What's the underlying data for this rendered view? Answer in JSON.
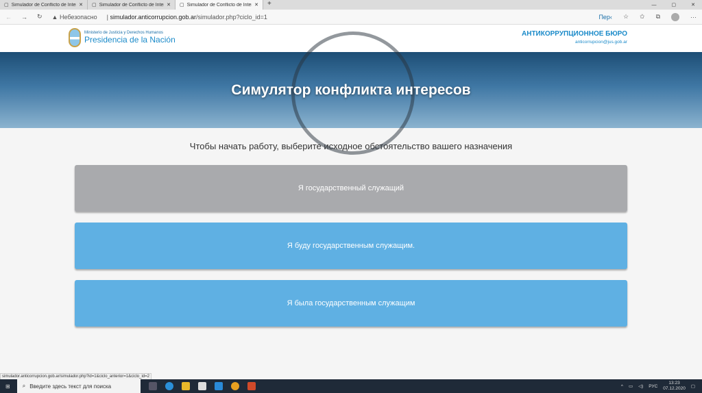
{
  "browser": {
    "tabs": [
      {
        "title": "Simulador de Conflicto de Intere"
      },
      {
        "title": "Simulador de Conflicto de Intere"
      },
      {
        "title": "Simulador de Conflicto de Intere"
      }
    ],
    "security": "Небезопасно",
    "url_host": "simulador.anticorrupcion.gob.ar",
    "url_path": "/simulador.php?ciclo_id=1",
    "translate": "Пер‹",
    "status_url": "simulador.anticorrupcion.gob.ar/simulador.php?id=1&ciclo_anterior=1&ciclo_id=2"
  },
  "header": {
    "ministry": "Ministerio de Justicia y Derechos Humanos",
    "presidency": "Presidencia de la Nación",
    "office": "АНТИКОРРУПЦИОННОЕ БЮРО",
    "email": "anticorrupcion@jus.gob.ar"
  },
  "banner": {
    "title": "Симулятор конфликта интересов"
  },
  "main": {
    "prompt": "Чтобы начать работу, выберите исходное обстоятельство вашего назначения",
    "options": [
      {
        "label": "Я государственный служащий",
        "color": "#a9aaad"
      },
      {
        "label": "Я буду государственным служащим.",
        "color": "#5fb0e3"
      },
      {
        "label": "Я была государственным служащим",
        "color": "#5fb0e3"
      }
    ]
  },
  "taskbar": {
    "search_placeholder": "Введите здесь текст для поиска",
    "lang": "РУС",
    "time": "13:23",
    "date": "07.12.2020"
  }
}
